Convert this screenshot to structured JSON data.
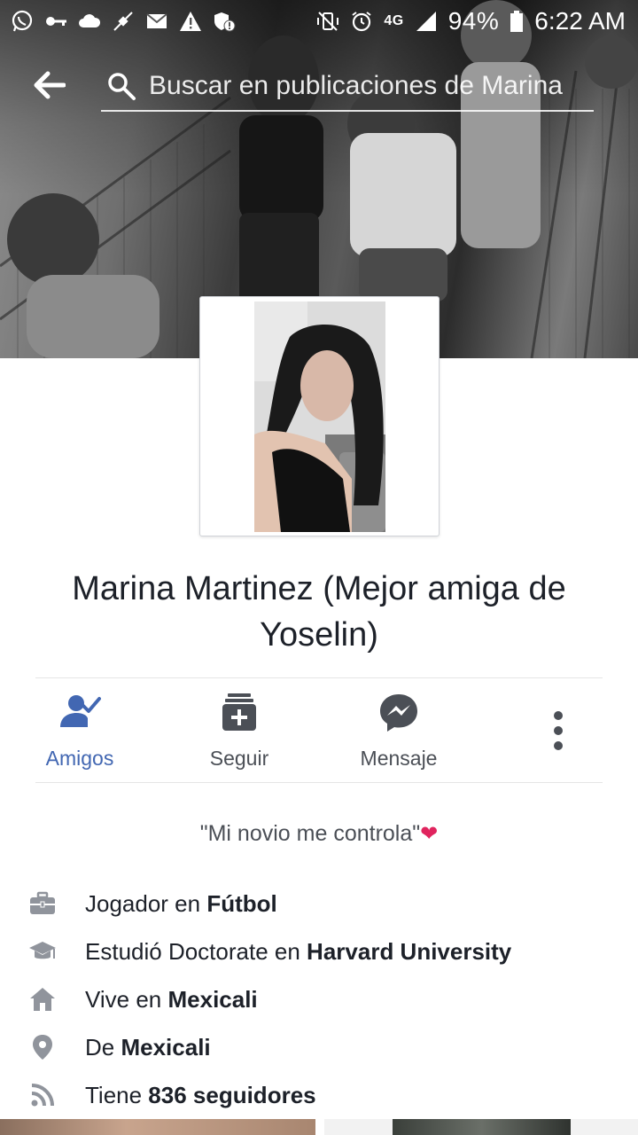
{
  "status_bar": {
    "left_icons": [
      "whatsapp-icon",
      "key-icon",
      "cloud-icon",
      "satellite-icon",
      "mail-icon",
      "warning-icon",
      "shield-alert-icon"
    ],
    "right_icons": [
      "mute-vibrate-icon",
      "alarm-icon",
      "network-4g-icon",
      "signal-icon",
      "battery-icon"
    ],
    "network": "4G",
    "battery": "94%",
    "time": "6:22 AM"
  },
  "topbar": {
    "search_placeholder": "Buscar en publicaciones de Marina"
  },
  "profile": {
    "name": "Marina Martinez (Mejor amiga de Yoselin)"
  },
  "actions": {
    "friends_label": "Amigos",
    "follow_label": "Seguir",
    "message_label": "Mensaje"
  },
  "bio": {
    "text": "\"Mi novio me controla\"",
    "emoji": "❤"
  },
  "intro": {
    "work": {
      "prefix": "Jogador en ",
      "value": "Fútbol"
    },
    "education": {
      "prefix": "Estudió Doctorate en ",
      "value": "Harvard University"
    },
    "lives": {
      "prefix": "Vive en ",
      "value": "Mexicali"
    },
    "from": {
      "prefix": "De ",
      "value": "Mexicali"
    },
    "followers": {
      "prefix": "Tiene ",
      "value": "836 seguidores"
    }
  },
  "colors": {
    "accent": "#4267b2",
    "text_primary": "#1d2129",
    "text_secondary": "#4b4f56",
    "icon_gray": "#90949c"
  }
}
